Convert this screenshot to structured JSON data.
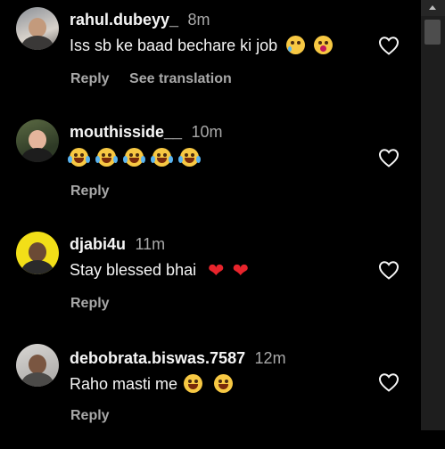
{
  "comments": [
    {
      "username": "rahul.dubeyy_",
      "time": "8m",
      "text": "Iss sb ke baad bechare ki job",
      "emojis": [
        "pleading-face-with-tear",
        "hushed-face"
      ],
      "actions": {
        "reply": "Reply",
        "translate": "See translation"
      }
    },
    {
      "username": "mouthisside__",
      "time": "10m",
      "text": "",
      "emojis": [
        "face-with-tears-of-joy",
        "face-with-tears-of-joy",
        "face-with-tears-of-joy",
        "face-with-tears-of-joy",
        "face-with-tears-of-joy"
      ],
      "actions": {
        "reply": "Reply"
      }
    },
    {
      "username": "djabi4u",
      "time": "11m",
      "text": "Stay blessed bhai",
      "emojis": [
        "red-heart",
        "red-heart"
      ],
      "actions": {
        "reply": "Reply"
      }
    },
    {
      "username": "debobrata.biswas.7587",
      "time": "12m",
      "text": "Raho masti me",
      "emojis": [
        "grinning-squinting-face",
        "grinning-squinting-face"
      ],
      "actions": {
        "reply": "Reply"
      }
    }
  ],
  "icons": {
    "like": "heart-outline-icon",
    "scroll_up": "triangle-up-icon"
  },
  "colors": {
    "background": "#000000",
    "text": "#f5f5f5",
    "secondary_text": "#a8a8a8",
    "heart": "#e8242c",
    "scrollbar_track": "#1e1e1e",
    "scrollbar_thumb": "#4d4d4d"
  }
}
